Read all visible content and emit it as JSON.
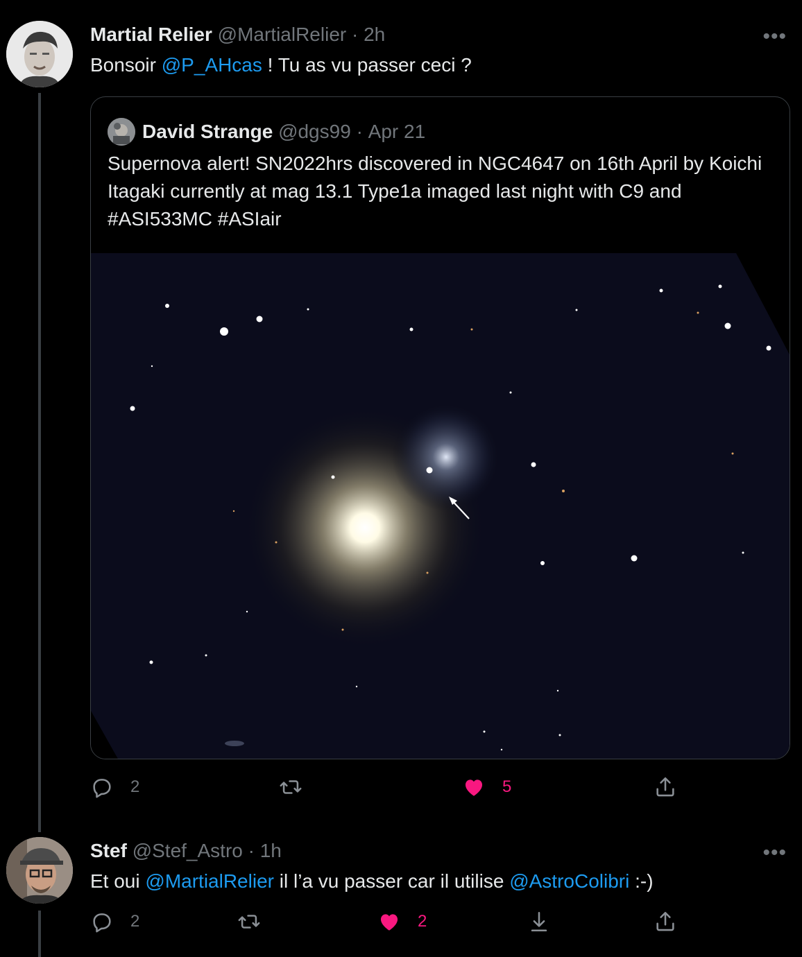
{
  "tweet1": {
    "author_name": "Martial Relier",
    "handle": "@MartialRelier",
    "time": "2h",
    "text_prefix": "Bonsoir ",
    "mention": "@P_AHcas",
    "text_suffix": "  !  Tu as vu passer ceci ?",
    "quote": {
      "author_name": "David Strange",
      "handle": "@dgs99",
      "time": "Apr 21",
      "text": "Supernova alert! SN2022hrs discovered in NGC4647 on 16th April by Koichi Itagaki currently at mag 13.1 Type1a imaged last night with C9 and #ASI533MC #ASIair"
    },
    "replies": "2",
    "retweets": "",
    "likes": "5"
  },
  "tweet2": {
    "author_name": "Stef",
    "handle": "@Stef_Astro",
    "time": "1h",
    "text_prefix": "Et oui ",
    "mention1": "@MartialRelier",
    "text_middle": " il l’a vu passer car il utilise ",
    "mention2": "@AstroColibri",
    "text_suffix": "  :-)",
    "replies": "2",
    "retweets": "",
    "likes": "2"
  },
  "ui": {
    "dot": "·",
    "more": "•••",
    "accent": "#1d9bf0",
    "like_color": "#f91880",
    "muted": "#71767b"
  }
}
